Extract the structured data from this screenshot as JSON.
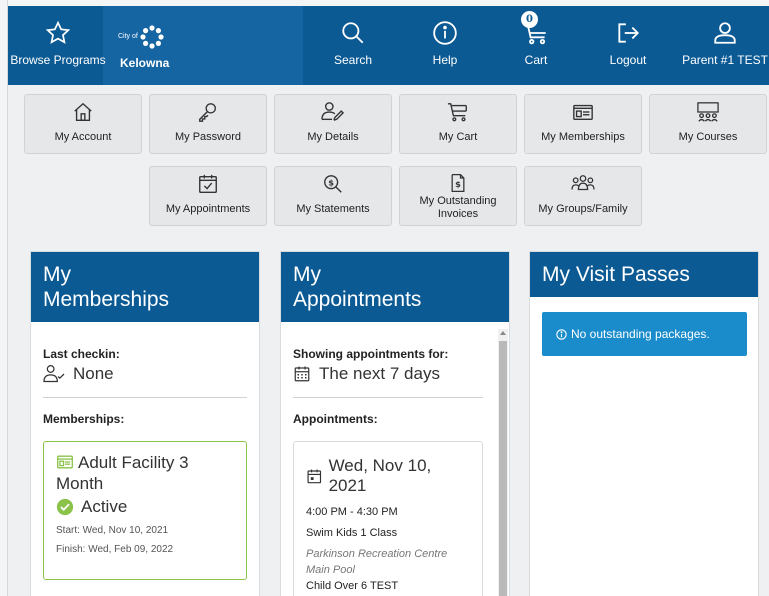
{
  "header": {
    "browse_label": "Browse Programs",
    "logo_city": "City of",
    "logo_name": "Kelowna",
    "search_label": "Search",
    "help_label": "Help",
    "cart_label": "Cart",
    "cart_count": "0",
    "logout_label": "Logout",
    "user_label": "Parent #1 TEST"
  },
  "tiles": {
    "account": "My Account",
    "password": "My Password",
    "details": "My Details",
    "cart": "My Cart",
    "memberships": "My Memberships",
    "courses": "My Courses",
    "appointments": "My Appointments",
    "statements": "My Statements",
    "invoices_line1": "My Outstanding",
    "invoices_line2": "Invoices",
    "groups": "My Groups/Family"
  },
  "memberships_card": {
    "title_line1": "My",
    "title_line2": "Memberships",
    "last_checkin_label": "Last checkin:",
    "last_checkin_value": "None",
    "memberships_label": "Memberships:",
    "membership_name": "Adult Facility 3 Month",
    "membership_status": "Active",
    "start": "Start: Wed, Nov 10, 2021",
    "finish": "Finish: Wed, Feb 09, 2022"
  },
  "appointments_card": {
    "title_line1": "My",
    "title_line2": "Appointments",
    "showing_label": "Showing appointments for:",
    "showing_value": "The next 7 days",
    "appointments_label": "Appointments:",
    "appt_date": "Wed, Nov 10, 2021",
    "appt_time": "4:00 PM - 4:30 PM",
    "appt_class": "Swim Kids 1 Class",
    "appt_location_line1": "Parkinson Recreation Centre",
    "appt_location_line2": "Main Pool",
    "appt_person": "Child Over 6 TEST"
  },
  "visit_passes_card": {
    "title": "My Visit Passes",
    "alert": "No outstanding packages."
  },
  "colors": {
    "header_blue": "#0b5a94",
    "active_green": "#8bc34a",
    "info_blue": "#1a8ccc"
  }
}
